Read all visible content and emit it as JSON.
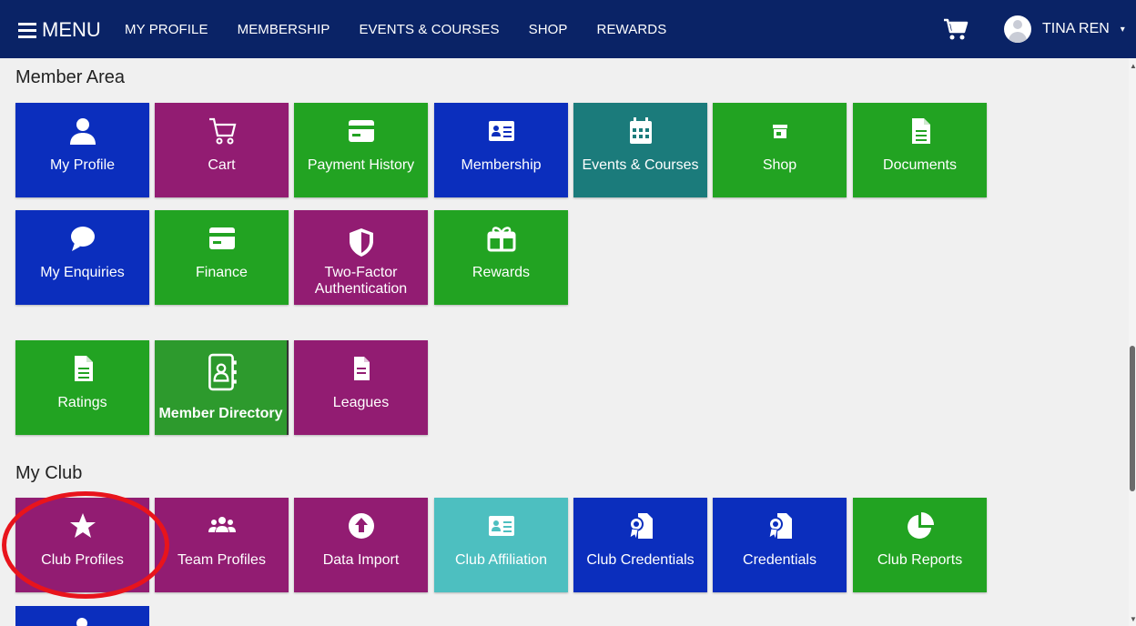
{
  "header": {
    "menu_label": "MENU",
    "nav": [
      "MY PROFILE",
      "MEMBERSHIP",
      "EVENTS & COURSES",
      "SHOP",
      "REWARDS"
    ],
    "user_name": "TINA REN",
    "caret": "▾"
  },
  "member_area": {
    "title": "Member Area",
    "tiles": [
      {
        "label": "My Profile",
        "icon": "person-icon",
        "color": "#0b2ebd"
      },
      {
        "label": "Cart",
        "icon": "cart-icon",
        "color": "#921c72"
      },
      {
        "label": "Payment History",
        "icon": "credit-card-icon",
        "color": "#22a322"
      },
      {
        "label": "Membership",
        "icon": "id-card-icon",
        "color": "#0b2ebd"
      },
      {
        "label": "Events & Courses",
        "icon": "calendar-icon",
        "color": "#1b7b7b"
      },
      {
        "label": "Shop",
        "icon": "store-icon",
        "color": "#22a322"
      },
      {
        "label": "Documents",
        "icon": "document-icon",
        "color": "#22a322"
      },
      {
        "label": "My Enquiries",
        "icon": "chat-bubble-icon",
        "color": "#0b2ebd"
      },
      {
        "label": "Finance",
        "icon": "credit-card-icon",
        "color": "#22a322"
      },
      {
        "label": "Two-Factor Authentication",
        "icon": "shield-icon",
        "color": "#921c72"
      },
      {
        "label": "Rewards",
        "icon": "gift-icon",
        "color": "#22a322"
      },
      {
        "label": "Ratings",
        "icon": "document-icon",
        "color": "#22a322"
      },
      {
        "label": "Member Directory",
        "icon": "address-book-icon",
        "color": "#2d9a2d"
      },
      {
        "label": "Leagues",
        "icon": "document-icon",
        "color": "#921c72"
      }
    ]
  },
  "my_club": {
    "title": "My Club",
    "tiles": [
      {
        "label": "Club Profiles",
        "icon": "star-icon",
        "color": "#921c72"
      },
      {
        "label": "Team Profiles",
        "icon": "group-icon",
        "color": "#921c72"
      },
      {
        "label": "Data Import",
        "icon": "upload-icon",
        "color": "#921c72"
      },
      {
        "label": "Club Affiliation",
        "icon": "id-card-icon",
        "color": "#4dbfc0"
      },
      {
        "label": "Club Credentials",
        "icon": "certificate-icon",
        "color": "#0b2ebd"
      },
      {
        "label": "Credentials",
        "icon": "certificate-icon",
        "color": "#0b2ebd"
      },
      {
        "label": "Club Reports",
        "icon": "pie-chart-icon",
        "color": "#22a322"
      }
    ]
  },
  "colors": {
    "header_bg": "#0a2366",
    "highlight_ring": "#e8141c"
  }
}
